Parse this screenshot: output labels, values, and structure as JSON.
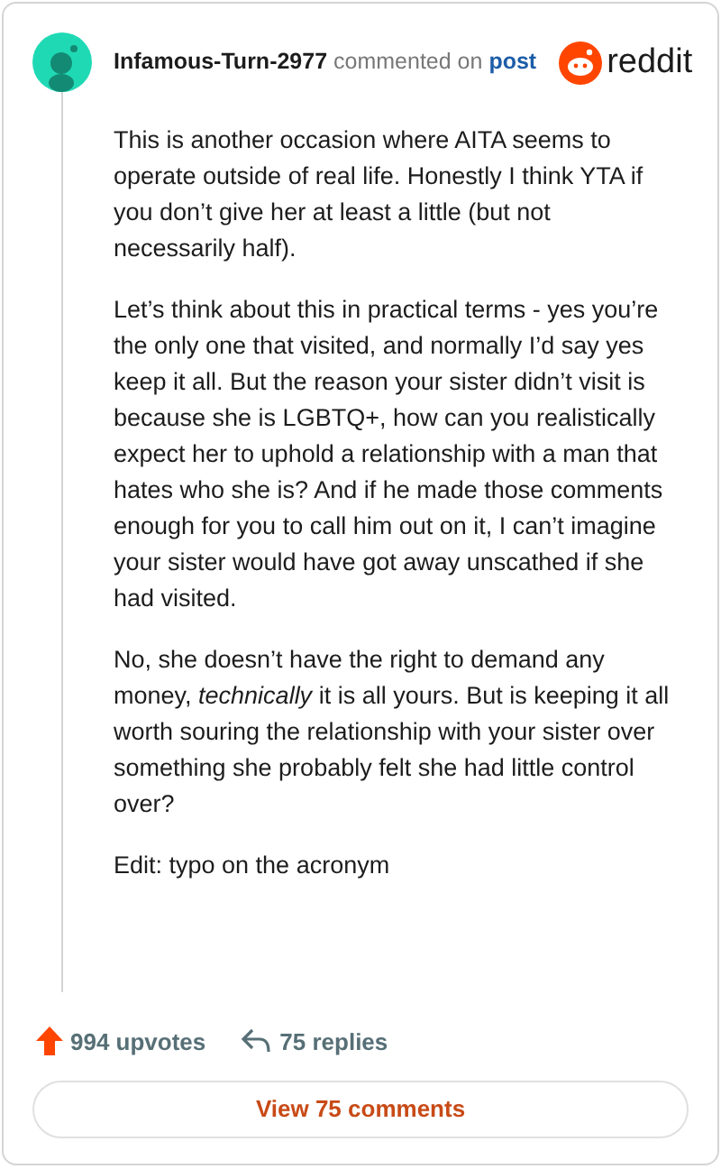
{
  "header": {
    "username": "Infamous-Turn-2977",
    "action": "commented on",
    "link": "post",
    "logo_text": "reddit"
  },
  "paragraphs": [
    "This is another occasion where AITA seems to operate outside of real life. Honestly I think YTA if you don’t give her at least a little (but not necessarily half).",
    "Let’s think about this in practical terms - yes you’re the only one that visited, and normally I’d say yes keep it all. But the reason your sister didn’t visit is because she is LGBTQ+, how can you realistically expect her to uphold a relationship with a man that hates who she is? And if he made those comments enough for you to call him out on it, I can’t imagine your sister would have got away unscathed if she had visited.",
    "No, she doesn’t have the right to demand any money, *technically* it is all yours. But is keeping it all worth souring the relationship with your sister over something she probably felt she had little control over?",
    "Edit: typo on the acronym"
  ],
  "footer": {
    "upvotes": "994 upvotes",
    "replies": "75 replies",
    "button": "View 75 comments"
  }
}
